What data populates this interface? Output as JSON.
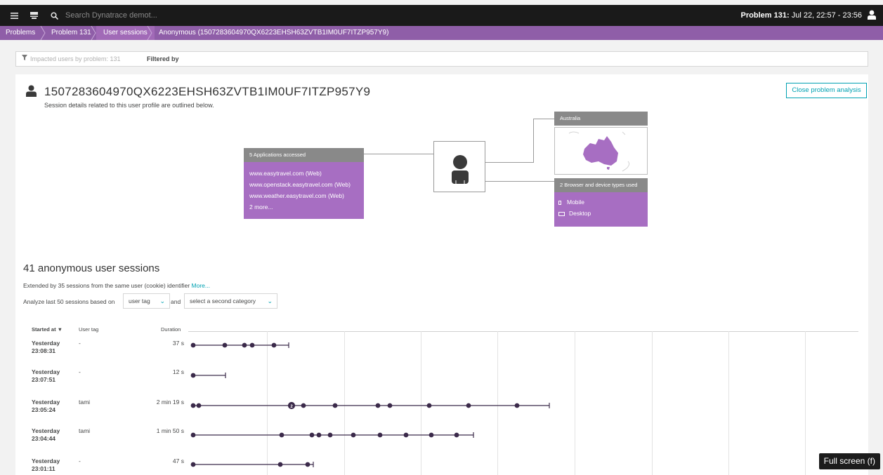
{
  "topbar": {
    "search_placeholder": "Search Dynatrace demot...",
    "problem_label": "Problem 131:",
    "problem_time": "Jul 22, 22:57 - 23:56"
  },
  "breadcrumb": [
    "Problems",
    "Problem 131",
    "User sessions",
    "Anonymous (1507283604970QX6223EHSH63ZVTB1IM0UF7ITZP957Y9)"
  ],
  "filter": {
    "placeholder": "Impacted users by problem: 131",
    "label": "Filtered by"
  },
  "profile": {
    "id": "1507283604970QX6223EHSH63ZVTB1IM0UF7ITZP957Y9",
    "subtitle": "Session details related to this user profile are outlined below.",
    "close_button": "Close problem analysis"
  },
  "diagram": {
    "apps_header": "5 Applications accessed",
    "apps": [
      "www.easytravel.com (Web)",
      "www.openstack.easytravel.com (Web)",
      "www.weather.easytravel.com (Web)",
      "2 more..."
    ],
    "location_header": "Australia",
    "devices_header": "2 Browser and device types used",
    "devices": [
      "Mobile",
      "Desktop"
    ]
  },
  "sessions": {
    "title": "41 anonymous user sessions",
    "extended_text": "Extended by 35 sessions from the same user (cookie) identifier",
    "more_link": "More...",
    "analyze_label": "Analyze last 50 sessions based on",
    "first_category": "user tag",
    "and_label": "and",
    "second_category": "select a second category",
    "columns": {
      "started": "Started at ▼",
      "user_tag": "User tag",
      "duration": "Duration"
    },
    "rows": [
      {
        "day": "Yesterday",
        "time": "23:08:31",
        "tag": "-",
        "duration": "37 s"
      },
      {
        "day": "Yesterday",
        "time": "23:07:51",
        "tag": "-",
        "duration": "12 s"
      },
      {
        "day": "Yesterday",
        "time": "23:05:24",
        "tag": "tami",
        "duration": "2 min 19 s"
      },
      {
        "day": "Yesterday",
        "time": "23:04:44",
        "tag": "tami",
        "duration": "1 min 50 s"
      },
      {
        "day": "Yesterday",
        "time": "23:01:11",
        "tag": "-",
        "duration": "47 s"
      }
    ],
    "cluster_badge": "2"
  },
  "overlay": {
    "fullscreen": "Full screen (f)"
  },
  "colors": {
    "accent": "#00a1b2",
    "purple": "#a76ec2",
    "crumb_purple": "#8f5ea8",
    "timeline": "#3b2a4a"
  }
}
